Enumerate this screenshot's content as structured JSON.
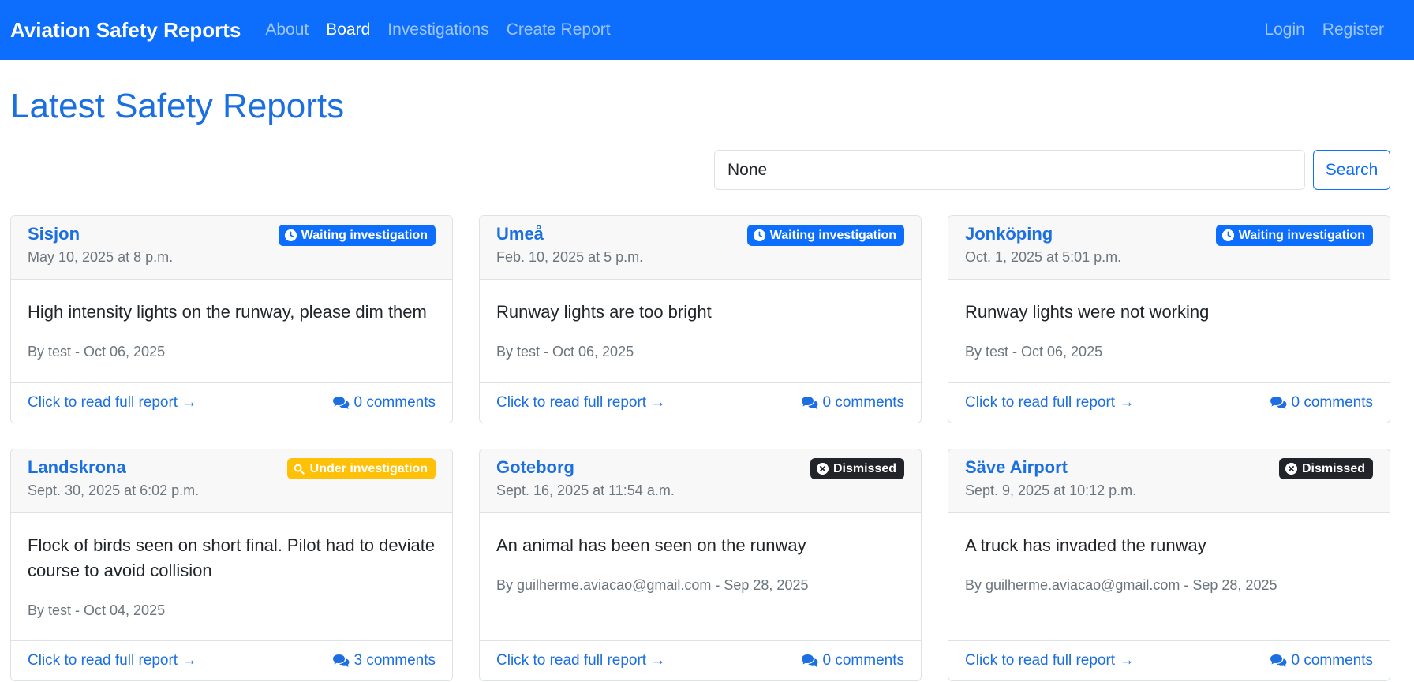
{
  "navbar": {
    "brand": "Aviation Safety Reports",
    "links": [
      "About",
      "Board",
      "Investigations",
      "Create Report"
    ],
    "right_links": [
      "Login",
      "Register"
    ]
  },
  "page": {
    "title": "Latest Safety Reports"
  },
  "search": {
    "value": "None",
    "button_label": "Search"
  },
  "colors": {
    "primary": "#0d6efd",
    "waiting_badge": "#0d6efd",
    "under_badge": "#ffc107",
    "dismissed_badge": "#212529"
  },
  "reports": [
    {
      "location": "Sisjon",
      "date": "May 10, 2025 at 8 p.m.",
      "status": "Waiting investigation",
      "status_icon": "clock-icon",
      "description": "High intensity lights on the runway, please dim them",
      "meta": "By test - Oct 06, 2025",
      "link": "Click to read full report →",
      "comments": "0 comments"
    },
    {
      "location": "Umeå",
      "date": "Feb. 10, 2025 at 5 p.m.",
      "status": "Waiting investigation",
      "status_icon": "clock-icon",
      "description": "Runway lights are too bright",
      "meta": "By test - Oct 06, 2025",
      "link": "Click to read full report →",
      "comments": "0 comments"
    },
    {
      "location": "Jonköping",
      "date": "Oct. 1, 2025 at 5:01 p.m.",
      "status": "Waiting investigation",
      "status_icon": "clock-icon",
      "description": "Runway lights were not working",
      "meta": "By test - Oct 06, 2025",
      "link": "Click to read full report →",
      "comments": "0 comments"
    },
    {
      "location": "Landskrona",
      "date": "Sept. 30, 2025 at 6:02 p.m.",
      "status": "Under investigation",
      "status_icon": "search-icon",
      "description": "Flock of birds seen on short final. Pilot had to deviate course to avoid collision",
      "meta": "By test - Oct 04, 2025",
      "link": "Click to read full report →",
      "comments": "3 comments"
    },
    {
      "location": "Goteborg",
      "date": "Sept. 16, 2025 at 11:54 a.m.",
      "status": "Dismissed",
      "status_icon": "x-circle-icon",
      "description": "An animal has been seen on the runway",
      "meta": "By guilherme.aviacao@gmail.com - Sep 28, 2025",
      "link": "Click to read full report →",
      "comments": "0 comments"
    },
    {
      "location": "Säve Airport",
      "date": "Sept. 9, 2025 at 10:12 p.m.",
      "status": "Dismissed",
      "status_icon": "x-circle-icon",
      "description": "A truck has invaded the runway",
      "meta": "By guilherme.aviacao@gmail.com - Sep 28, 2025",
      "link": "Click to read full report →",
      "comments": "0 comments"
    }
  ]
}
